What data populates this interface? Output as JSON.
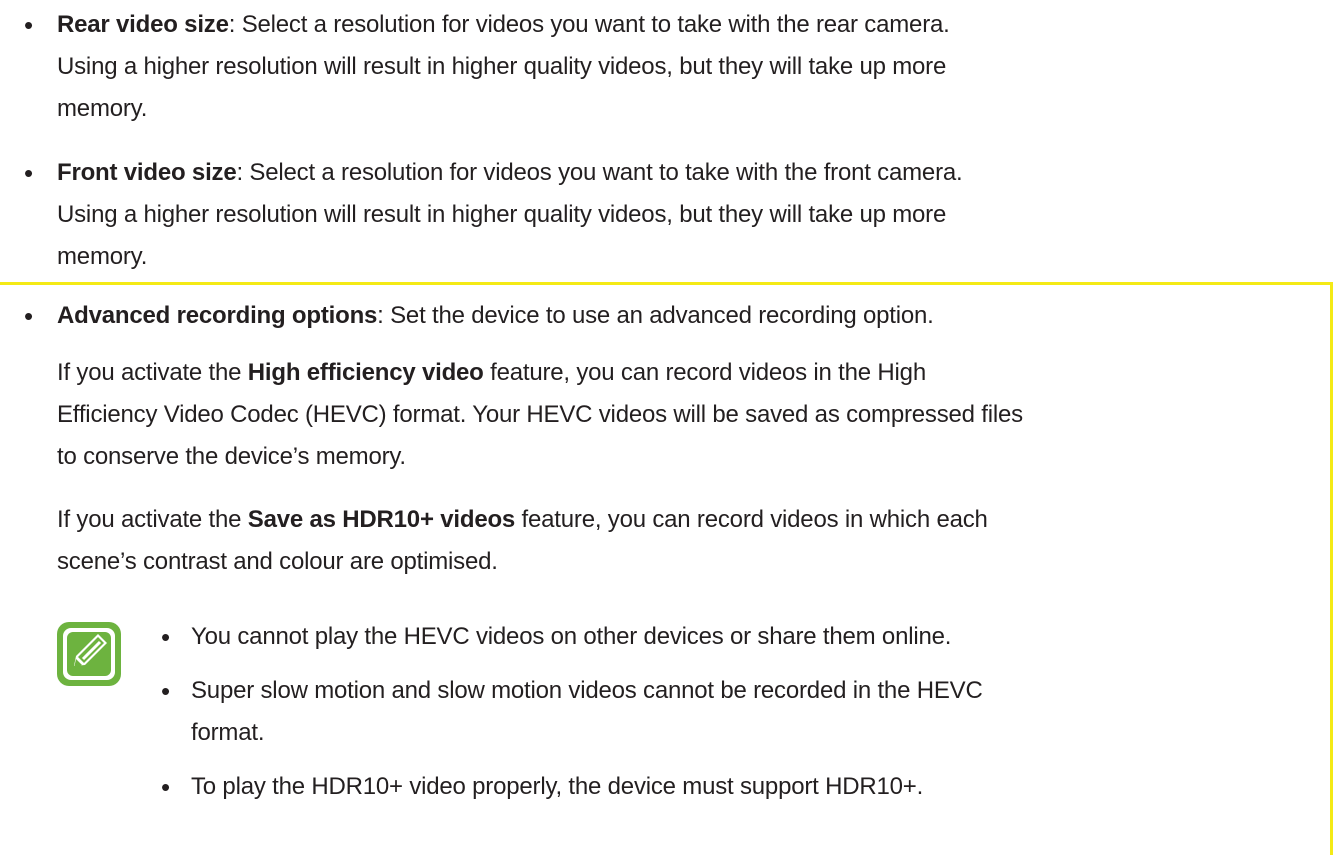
{
  "bullet": "•",
  "items": [
    {
      "term": "Rear video size",
      "rest": ": Select a resolution for videos you want to take with the rear camera.",
      "line2": "Using a higher resolution will result in higher quality videos, but they will take up more",
      "line3": "memory."
    },
    {
      "term": "Front video size",
      "rest": ": Select a resolution for videos you want to take with the front camera.",
      "line2": "Using a higher resolution will result in higher quality videos, but they will take up more",
      "line3": "memory."
    },
    {
      "term": "Advanced recording options",
      "rest": ": Set the device to use an advanced recording option."
    }
  ],
  "para1": {
    "prefix": "If you activate the ",
    "bold": "High efficiency video",
    "suffix": " feature, you can record videos in the High",
    "line2": "Efficiency Video Codec (HEVC) format. Your HEVC videos will be saved as compressed files",
    "line3": "to conserve the device’s memory."
  },
  "para2": {
    "prefix": "If you activate the ",
    "bold": "Save as HDR10+ videos",
    "suffix": " feature, you can record videos in which each",
    "line2": "scene’s contrast and colour are optimised."
  },
  "notes": [
    {
      "line1": "You cannot play the HEVC videos on other devices or share them online."
    },
    {
      "line1": "Super slow motion and slow motion videos cannot be recorded in the HEVC",
      "line2": "format."
    },
    {
      "line1": "To play the HDR10+ video properly, the device must support HDR10+."
    }
  ],
  "colors": {
    "highlight": "#f4ea16",
    "note_icon": "#6db33f",
    "text": "#231f20"
  },
  "icons": {
    "note": "note-pencil-icon"
  }
}
